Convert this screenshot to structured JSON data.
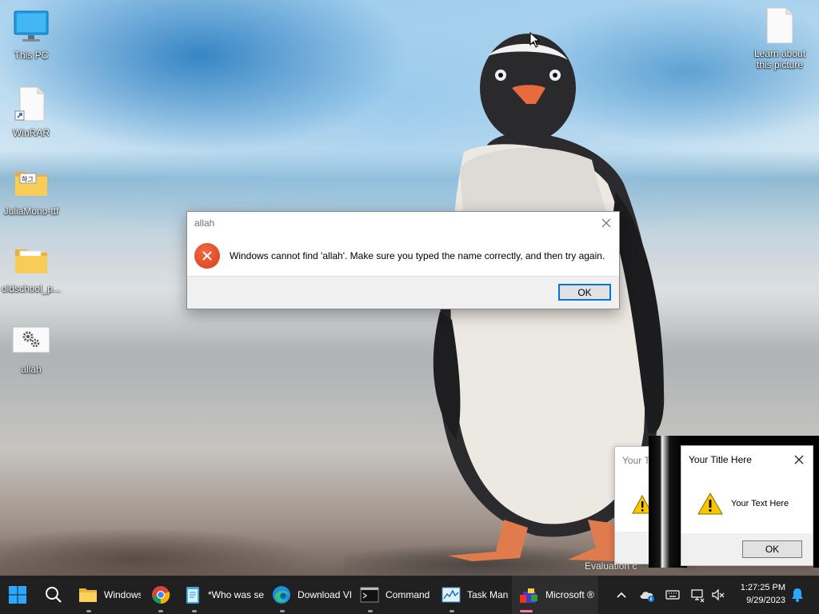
{
  "desktop": {
    "icons": [
      {
        "label": "This PC",
        "icon": "monitor-icon"
      },
      {
        "label": "WinRAR",
        "icon": "shortcut-file-icon"
      },
      {
        "label": "JuliaMono-ttf",
        "icon": "folder-icon"
      },
      {
        "label": "oldschool_p...",
        "icon": "folder-icon"
      },
      {
        "label": "allah",
        "icon": "settings-file-icon"
      },
      {
        "label": "Learn about this picture",
        "icon": "blank-file-icon"
      }
    ]
  },
  "error_dialog": {
    "title": "allah",
    "message": "Windows cannot find 'allah'. Make sure you typed the name correctly, and then try again.",
    "ok_label": "OK",
    "icon": "error-icon"
  },
  "msgbox_back": {
    "title": "Your T",
    "icon": "warning-icon"
  },
  "msgbox_front": {
    "title": "Your Title Here",
    "text": "Your Text Here",
    "ok_label": "OK",
    "icon": "warning-icon"
  },
  "watermark": "Evaluation c",
  "taskbar": {
    "apps": [
      {
        "label": "Windows",
        "icon": "file-explorer-icon"
      },
      {
        "label": "",
        "icon": "chrome-icon"
      },
      {
        "label": "*Who was se",
        "icon": "notepad-icon"
      },
      {
        "label": "Download VI",
        "icon": "edge-icon"
      },
      {
        "label": "Command",
        "icon": "command-prompt-icon"
      },
      {
        "label": "Task Mana",
        "icon": "task-manager-icon"
      },
      {
        "label": "Microsoft ®",
        "icon": "microsoft-app-icon"
      }
    ],
    "time": "1:27:25 PM",
    "date": "9/29/2023"
  },
  "colors": {
    "taskbar_bg": "#202020",
    "accent": "#0078d7",
    "error_red": "#d93d17",
    "warning_yellow": "#f7c600"
  }
}
